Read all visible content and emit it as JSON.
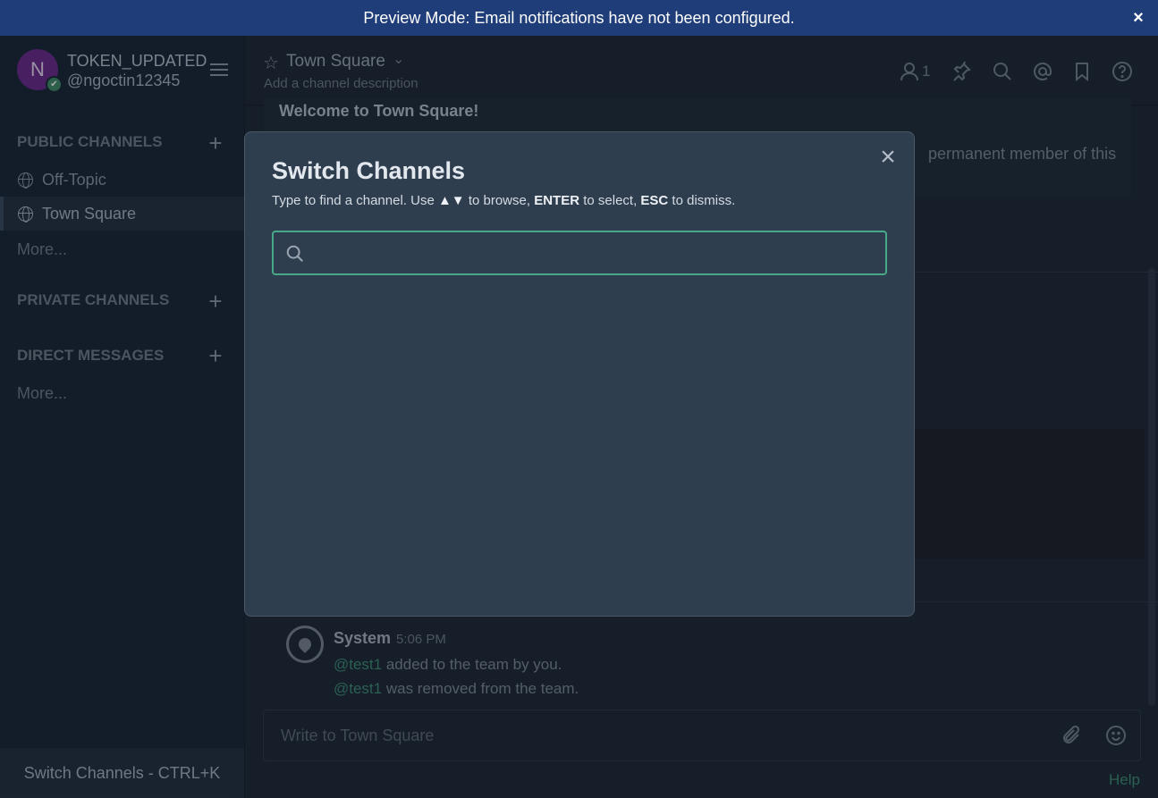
{
  "banner": {
    "text": "Preview Mode: Email notifications have not been configured.",
    "close": "×"
  },
  "sidebar": {
    "avatar_initial": "N",
    "team_name": "TOKEN_UPDATED",
    "user_handle": "@ngoctin12345",
    "public_channels_title": "PUBLIC CHANNELS",
    "public_channels": [
      {
        "label": "Off-Topic",
        "active": false
      },
      {
        "label": "Town Square",
        "active": true
      }
    ],
    "public_more": "More...",
    "private_channels_title": "PRIVATE CHANNELS",
    "direct_messages_title": "DIRECT MESSAGES",
    "dm_more": "More...",
    "switch_channels_footer": "Switch Channels - CTRL+K",
    "add_symbol": "+"
  },
  "channel_header": {
    "name": "Town Square",
    "description": "Add a channel description",
    "member_count": "1"
  },
  "welcome": {
    "title": "Welcome to Town Square!",
    "text_fragment": "permanent member of this"
  },
  "post": {
    "author": "System",
    "time": "5:06 PM",
    "lines": [
      {
        "mention": "@test1",
        "text": " added to the team by you."
      },
      {
        "mention": "@test1",
        "text": " was removed from the team."
      }
    ]
  },
  "composer": {
    "placeholder": "Write to Town Square"
  },
  "help_link": "Help",
  "modal": {
    "title": "Switch Channels",
    "hint_prefix": "Type to find a channel. Use ",
    "hint_arrows": "▲▼",
    "hint_mid1": " to browse, ",
    "hint_enter": "ENTER",
    "hint_mid2": " to select, ",
    "hint_esc": "ESC",
    "hint_suffix": " to dismiss.",
    "search_value": "",
    "close": "×"
  },
  "colors": {
    "banner": "#1f3d78",
    "sidebar": "#1a2634",
    "modal": "#2e3e4f",
    "accent": "#48a88a"
  }
}
